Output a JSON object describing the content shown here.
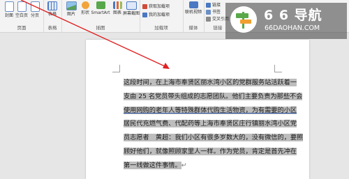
{
  "ribbon": {
    "pages_group": {
      "label": "页面",
      "buttons": [
        "封面",
        "空白页",
        "分页"
      ]
    },
    "tables_group": {
      "label": "表格",
      "buttons": [
        "表格"
      ]
    },
    "illustrations_group": {
      "label": "插图",
      "buttons": [
        "图片",
        "形状",
        "SmartArt",
        "图表",
        "屏幕截图"
      ]
    },
    "addins_group": {
      "label": "加载项",
      "items": [
        "获取加载项",
        "我的加载项"
      ]
    },
    "media_group": {
      "label": "媒体",
      "buttons": [
        "联机视频"
      ]
    },
    "links_group": {
      "label": "链接",
      "items": [
        "链接",
        "书签",
        "交叉引用"
      ]
    }
  },
  "document": {
    "lines": [
      "这段时间，在上海市奉贤区丽水湾小区的党群服务站活跃着一",
      "支由 25 名党员带头组成的志愿团队。他们主要负责为那些不会",
      "使用网购的老年人等特殊群体代购生活物资，为有需要的小区",
      "居民代充燃气费、代配药等上海市奉贤区庄行镇丽水湾小区党",
      "员志愿者　黄超：我们小区有很多岁数大的，没有微信的，要照",
      "顾好他们，就像照顾家里人一样。作为党员，肯定是首先冲在",
      "第一线做这件事情。"
    ],
    "return_mark": "↵"
  },
  "watermark": {
    "title": "6 6 导航",
    "url": "66DAOHAN.COM"
  },
  "colors": {
    "arrow": "#e02020",
    "selection": "#bdbdbd",
    "ribbon_bg": "#f3f3f3",
    "workspace_bg": "#e6e6e6"
  }
}
